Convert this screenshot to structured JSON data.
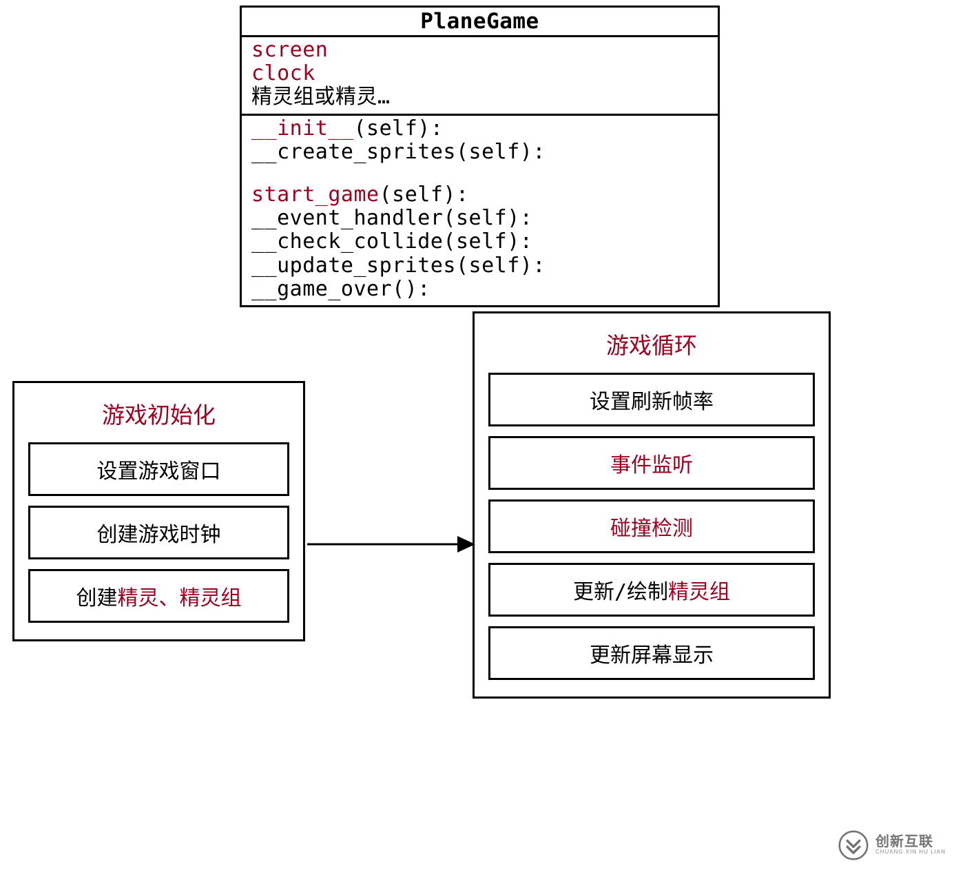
{
  "colors": {
    "accent": "#a00020",
    "border": "#000000"
  },
  "uml": {
    "title": "PlaneGame",
    "attrs": {
      "a1": "screen",
      "a2": "clock",
      "a3": "精灵组或精灵…"
    },
    "meth": {
      "m1_red": "__init__",
      "m1_rest": "(self):",
      "m2": "__create_sprites(self):",
      "m3_red": "start_game",
      "m3_rest": "(self):",
      "m4": "__event_handler(self):",
      "m5": "__check_collide(self):",
      "m6": "__update_sprites(self):",
      "m7": "__game_over():"
    }
  },
  "init": {
    "title": "游戏初始化",
    "s1": "设置游戏窗口",
    "s2": "创建游戏时钟",
    "s3a": "创建",
    "s3b": "精灵、精灵组"
  },
  "loop": {
    "title": "游戏循环",
    "s1": "设置刷新帧率",
    "s2": "事件监听",
    "s3": "碰撞检测",
    "s4a": "更新/绘制",
    "s4b": "精灵组",
    "s5": "更新屏幕显示"
  },
  "watermark": {
    "main": "创新互联",
    "sub": "CHUANG XIN HU LIAN"
  }
}
